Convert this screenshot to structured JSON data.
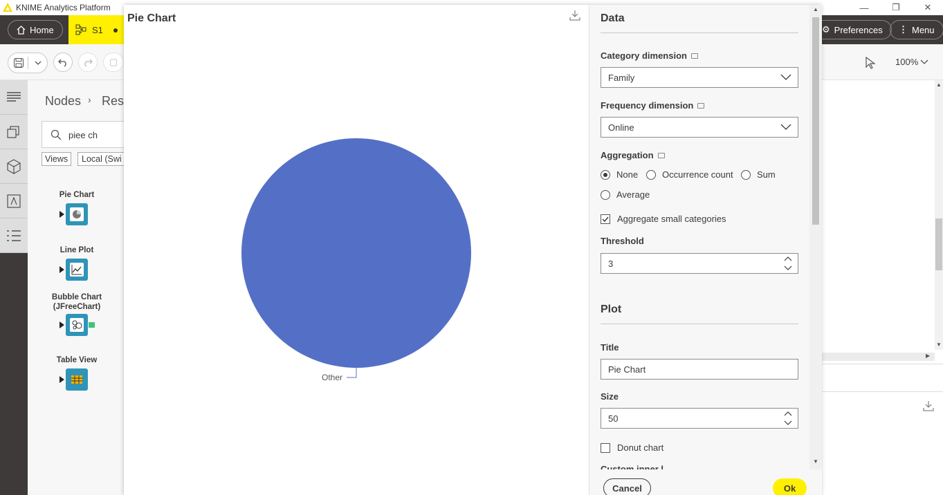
{
  "app": {
    "title": "KNIME Analytics Platform"
  },
  "header": {
    "home_label": "Home",
    "tab_label": "S1",
    "preferences_label": "Preferences",
    "menu_label": "Menu"
  },
  "toolbar": {
    "zoom": "100%"
  },
  "repo": {
    "breadcrumb_root": "Nodes",
    "breadcrumb_current": "Res",
    "search_value": "piee ch",
    "chips": [
      "Views",
      "Local (Swi"
    ],
    "nodes": [
      {
        "label": "Pie Chart",
        "icon": "pie-chart-icon"
      },
      {
        "label": "Line Plot",
        "icon": "line-plot-icon"
      },
      {
        "label": "Bubble Chart\n(JFreeChart)",
        "icon": "bubble-chart-icon"
      },
      {
        "label": "Table View",
        "icon": "table-view-icon"
      }
    ]
  },
  "view": {
    "title": "Pie Chart",
    "chart_data": {
      "type": "pie",
      "categories": [
        "Other"
      ],
      "values": [
        100
      ],
      "colors": [
        "#5470c6"
      ]
    }
  },
  "settings": {
    "data_title": "Data",
    "category_label": "Category dimension",
    "category_value": "Family",
    "frequency_label": "Frequency dimension",
    "frequency_value": "Online",
    "aggregation_label": "Aggregation",
    "agg_none": "None",
    "agg_occurrence": "Occurrence count",
    "agg_sum": "Sum",
    "agg_average": "Average",
    "aggregate_small": "Aggregate small categories",
    "threshold_label": "Threshold",
    "threshold_value": "3",
    "plot_title": "Plot",
    "title_label": "Title",
    "title_value": "Pie Chart",
    "size_label": "Size",
    "size_value": "50",
    "donut_label": "Donut chart",
    "cut_label": "Custom inner l"
  },
  "footer": {
    "cancel": "Cancel",
    "ok": "Ok"
  },
  "colors": {
    "accent": "#fff000",
    "header": "#3e3a39",
    "node": "#2f94b8",
    "pie": "#5470c6"
  }
}
